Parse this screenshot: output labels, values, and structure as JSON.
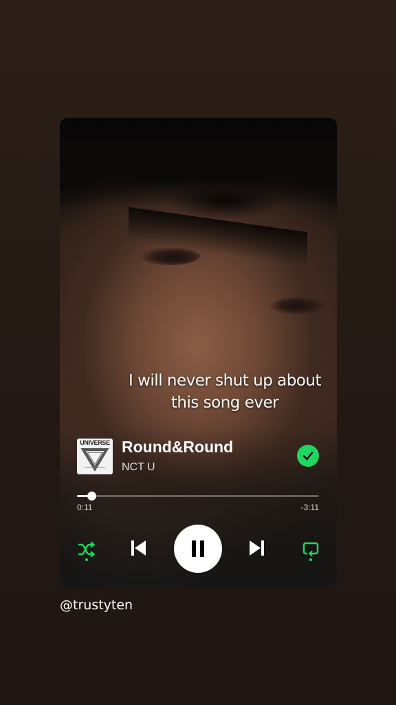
{
  "overlay_caption": "I will never shut up about this song ever",
  "album_art": {
    "label": "UNIVERSE",
    "icon": "album-cover-icon"
  },
  "track": {
    "title": "Round&Round",
    "artist": "NCT U"
  },
  "liked": {
    "state": true,
    "icon": "check-circle-icon",
    "color": "#1ed760"
  },
  "progress": {
    "elapsed": "0:11",
    "remaining": "-3:11",
    "fraction": 0.06
  },
  "controls": {
    "shuffle_icon": "shuffle-icon",
    "prev_icon": "skip-previous-icon",
    "play_state": "playing",
    "pause_icon": "pause-icon",
    "next_icon": "skip-next-icon",
    "repeat_icon": "repeat-icon",
    "accent": "#1ed760"
  },
  "username": "@trustyten"
}
